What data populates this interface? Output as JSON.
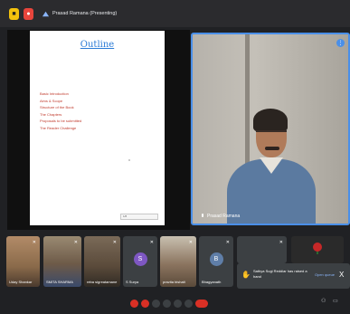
{
  "topbar": {
    "title": "Prasad Ramana (Presenting)"
  },
  "slide": {
    "title": "Outline",
    "bullets": [
      "Basic Introduction",
      "Aims & Scope",
      "Structure of the Book",
      "The Chapters",
      "Proposals to be submitted",
      "The Reader Challenge"
    ],
    "toolbar_text": "1/8"
  },
  "speaker": {
    "name": "Prasad Ramana"
  },
  "participants": [
    {
      "name": "Uday Shankar",
      "type": "photo",
      "color": "#8a6a4a"
    },
    {
      "name": "SMITA SHARMA",
      "type": "photo",
      "color": "#6d5a48"
    },
    {
      "name": "reba sigreatamane",
      "type": "photo",
      "color": "#5a4a3a"
    },
    {
      "name": "S Surya",
      "initial": "S",
      "type": "avatar",
      "color": "#7e57c2"
    },
    {
      "name": "pravita bishalt",
      "type": "photo",
      "color": "#8c7560"
    },
    {
      "name": "Bhagyanath",
      "initial": "B",
      "type": "avatar",
      "color": "#5f7ea8"
    },
    {
      "name": "",
      "type": "photo",
      "color": "#3b3b3b"
    }
  ],
  "notification": {
    "text": "Sathya Sugi Reddiar has raised a hand",
    "open_label": "Open queue",
    "close_label": "X"
  }
}
